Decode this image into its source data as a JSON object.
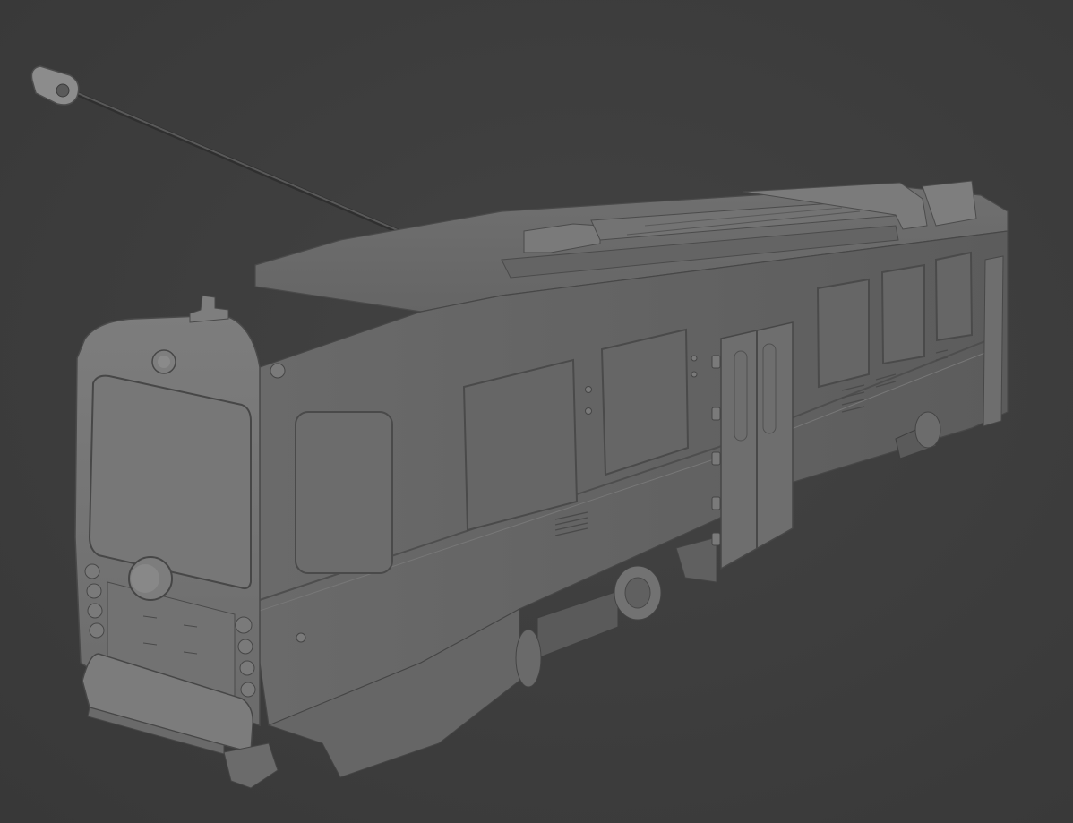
{
  "viewport": {
    "background": "#3d3d3d",
    "model_shade": "#6f6f6f",
    "subject": "tram-model"
  }
}
